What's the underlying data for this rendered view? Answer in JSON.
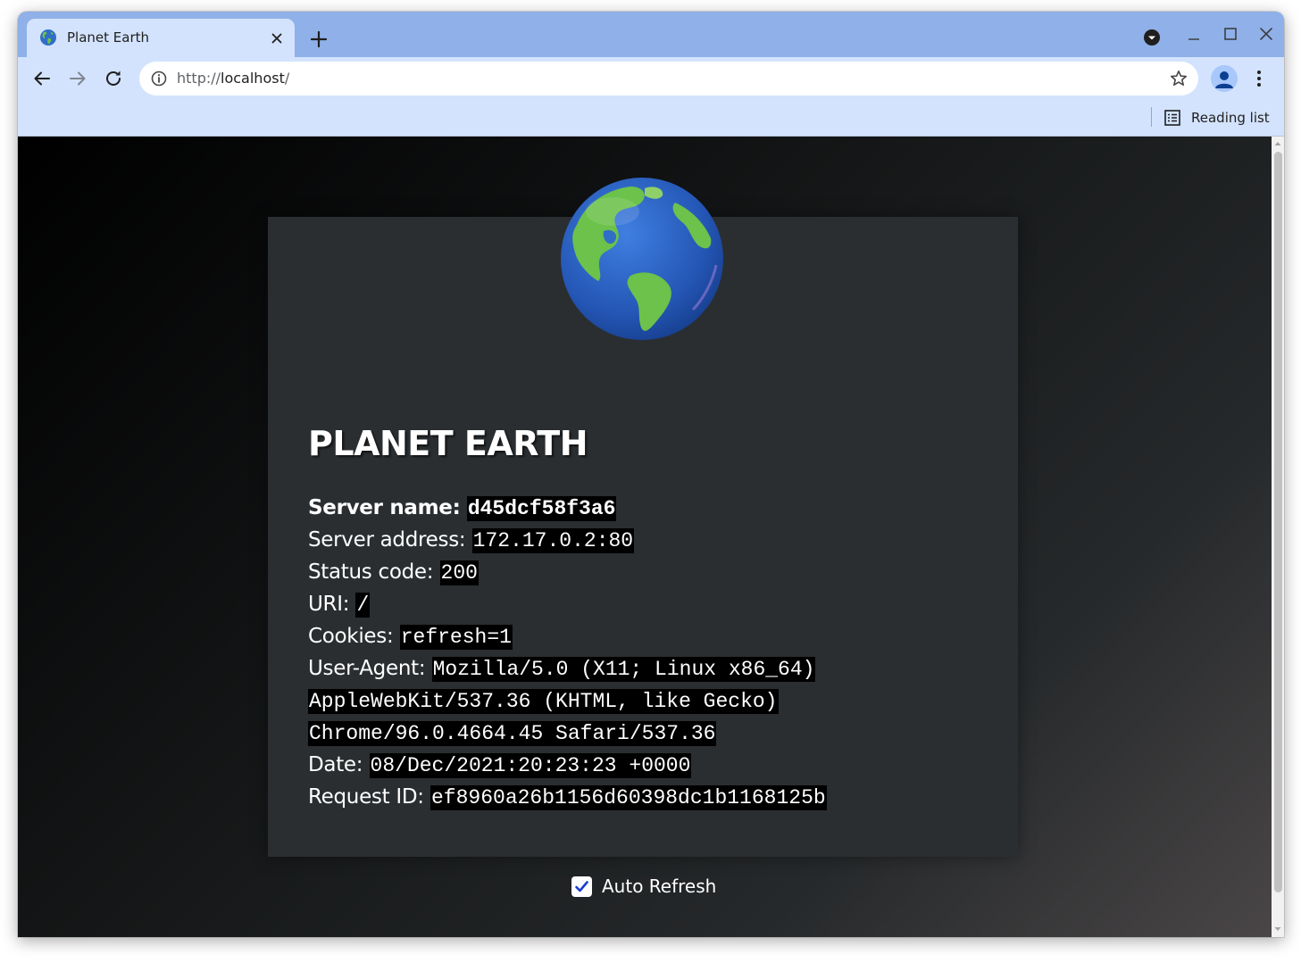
{
  "browser": {
    "tab": {
      "title": "Planet Earth",
      "favicon": "globe-americas-icon"
    },
    "url_scheme": "http://",
    "url_host": "localhost",
    "url_path": "/",
    "bookmarks": {
      "reading_list_label": "Reading list"
    },
    "accent_color": "#d3e3fd",
    "tabstrip_color": "#8fb0e8"
  },
  "page": {
    "title": "PLANET EARTH",
    "fields": {
      "server_name_label": "Server name:",
      "server_name": "d45dcf58f3a6",
      "server_address_label": "Server address:",
      "server_address": "172.17.0.2:80",
      "status_code_label": "Status code:",
      "status_code": "200",
      "uri_label": "URI:",
      "uri": "/",
      "cookies_label": "Cookies:",
      "cookies": "refresh=1",
      "user_agent_label": "User-Agent:",
      "user_agent_line1": "Mozilla/5.0 (X11; Linux x86_64)",
      "user_agent_line2": "AppleWebKit/537.36 (KHTML, like Gecko)",
      "user_agent_line3": "Chrome/96.0.4664.45 Safari/537.36",
      "date_label": "Date:",
      "date": "08/Dec/2021:20:23:23 +0000",
      "request_id_label": "Request ID:",
      "request_id": "ef8960a26b1156d60398dc1b1168125b"
    },
    "auto_refresh": {
      "label": "Auto Refresh",
      "checked": true
    },
    "card_color": "#2a2e31"
  }
}
